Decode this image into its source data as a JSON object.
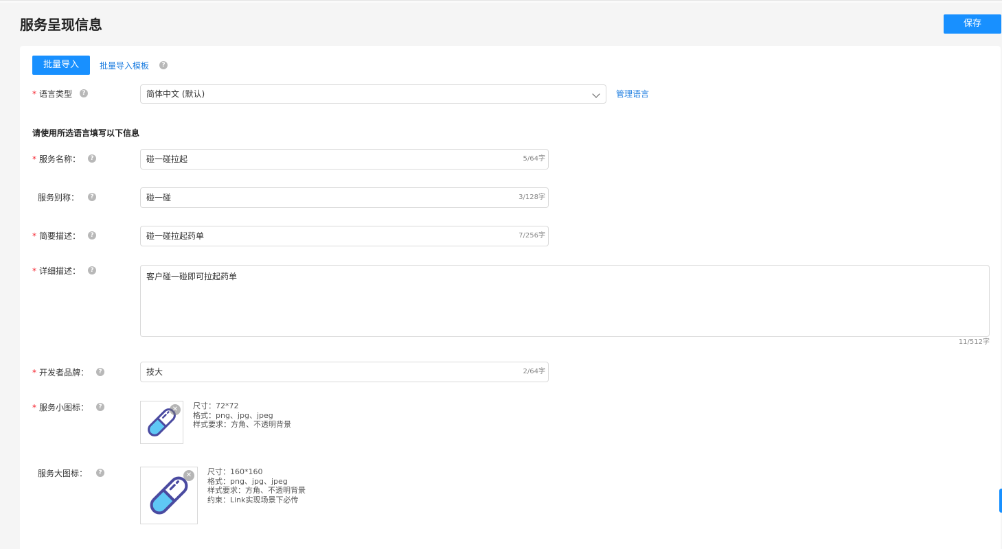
{
  "header": {
    "title": "服务呈现信息",
    "save_label": "保存"
  },
  "toolbar": {
    "import_label": "批量导入",
    "template_link": "批量导入模板",
    "help_icon": "question-icon"
  },
  "language": {
    "label": "语言类型",
    "value": "简体中文 (默认)",
    "manage_link": "管理语言"
  },
  "section_title": "请使用所选语言填写以下信息",
  "fields": {
    "name": {
      "label": "服务名称：",
      "value": "碰一碰拉起",
      "counter": "5/64字"
    },
    "alias": {
      "label": "服务别称：",
      "value": "碰一碰",
      "counter": "3/128字"
    },
    "brief": {
      "label": "简要描述：",
      "value": "碰一碰拉起药单",
      "counter": "7/256字"
    },
    "detail": {
      "label": "详细描述：",
      "value": "客户碰一碰即可拉起药单",
      "counter": "11/512字"
    },
    "brand": {
      "label": "开发者品牌：",
      "value": "技大",
      "counter": "2/64字"
    }
  },
  "small_icon": {
    "label": "服务小图标：",
    "hints": [
      "尺寸：72*72",
      "格式：png、jpg、jpeg",
      "样式要求：方角、不透明背景"
    ]
  },
  "large_icon": {
    "label": "服务大图标：",
    "hints": [
      "尺寸：160*160",
      "格式：png、jpg、jpeg",
      "样式要求：方角、不透明背景",
      "约束：Link实现场景下必传"
    ]
  },
  "colors": {
    "primary": "#1890ff",
    "required": "#f5222d",
    "pill_body": "#5fc8f5",
    "pill_outline": "#4a4aa0"
  }
}
